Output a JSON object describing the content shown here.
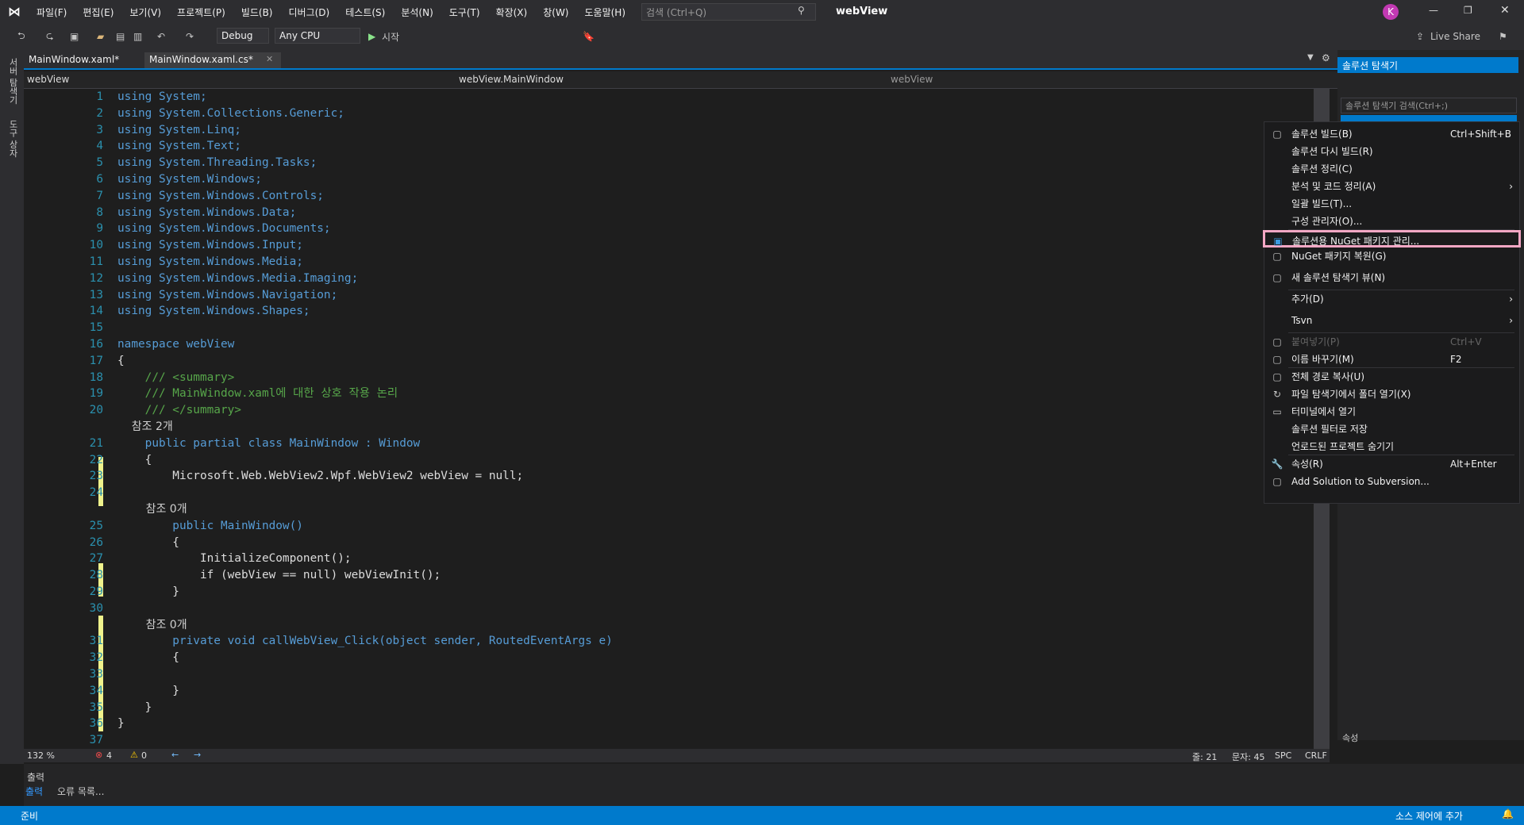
{
  "titlebar": {
    "menus": [
      "파일(F)",
      "편집(E)",
      "보기(V)",
      "프로젝트(P)",
      "빌드(B)",
      "디버그(D)",
      "테스트(S)",
      "분석(N)",
      "도구(T)",
      "확장(X)",
      "창(W)",
      "도움말(H)"
    ],
    "search_placeholder": "검색 (Ctrl+Q)",
    "project_name": "webView",
    "avatar_letter": "K"
  },
  "toolbar": {
    "config": "Debug",
    "platform": "Any CPU",
    "start_label": "시작",
    "live_share": "Live Share"
  },
  "leftbar": {
    "items": [
      "서버 탐색기",
      "도구 상자"
    ]
  },
  "editor": {
    "tabs": [
      {
        "label": "MainWindow.xaml*"
      },
      {
        "label": "MainWindow.xaml.cs*"
      }
    ],
    "nav": [
      "webView",
      "webView.MainWindow",
      "webView"
    ],
    "lines": [
      {
        "n": "1",
        "t": "using System;"
      },
      {
        "n": "2",
        "t": "using System.Collections.Generic;"
      },
      {
        "n": "3",
        "t": "using System.Linq;"
      },
      {
        "n": "4",
        "t": "using System.Text;"
      },
      {
        "n": "5",
        "t": "using System.Threading.Tasks;"
      },
      {
        "n": "6",
        "t": "using System.Windows;"
      },
      {
        "n": "7",
        "t": "using System.Windows.Controls;"
      },
      {
        "n": "8",
        "t": "using System.Windows.Data;"
      },
      {
        "n": "9",
        "t": "using System.Windows.Documents;"
      },
      {
        "n": "10",
        "t": "using System.Windows.Input;"
      },
      {
        "n": "11",
        "t": "using System.Windows.Media;"
      },
      {
        "n": "12",
        "t": "using System.Windows.Media.Imaging;"
      },
      {
        "n": "13",
        "t": "using System.Windows.Navigation;"
      },
      {
        "n": "14",
        "t": "using System.Windows.Shapes;"
      },
      {
        "n": "15",
        "t": ""
      },
      {
        "n": "16",
        "t": "namespace webView"
      },
      {
        "n": "17",
        "t": "{"
      },
      {
        "n": "18",
        "t": "    /// <summary>"
      },
      {
        "n": "19",
        "t": "    /// MainWindow.xaml에 대한 상호 작용 논리"
      },
      {
        "n": "20",
        "t": "    /// </summary>"
      },
      {
        "n": "",
        "t": "    참조 2개"
      },
      {
        "n": "21",
        "t": "    public partial class MainWindow : Window"
      },
      {
        "n": "22",
        "t": "    {"
      },
      {
        "n": "23",
        "t": "        Microsoft.Web.WebView2.Wpf.WebView2 webView = null;"
      },
      {
        "n": "24",
        "t": ""
      },
      {
        "n": "",
        "t": "        참조 0개"
      },
      {
        "n": "25",
        "t": "        public MainWindow()"
      },
      {
        "n": "26",
        "t": "        {"
      },
      {
        "n": "27",
        "t": "            InitializeComponent();"
      },
      {
        "n": "28",
        "t": "            if (webView == null) webViewInit();"
      },
      {
        "n": "29",
        "t": "        }"
      },
      {
        "n": "30",
        "t": ""
      },
      {
        "n": "",
        "t": "        참조 0개"
      },
      {
        "n": "31",
        "t": "        private void callWebView_Click(object sender, RoutedEventArgs e)"
      },
      {
        "n": "32",
        "t": "        {"
      },
      {
        "n": "33",
        "t": ""
      },
      {
        "n": "34",
        "t": "        }"
      },
      {
        "n": "35",
        "t": "    }"
      },
      {
        "n": "36",
        "t": "}"
      },
      {
        "n": "37",
        "t": ""
      }
    ]
  },
  "solution_explorer": {
    "title": "솔루션 탐색기",
    "search_placeholder": "솔루션 탐색기 검색(Ctrl+;)",
    "properties_title": "속성"
  },
  "context_menu": {
    "items": [
      {
        "label": "솔루션 빌드(B)",
        "shortcut": "Ctrl+Shift+B",
        "icon": "build-icon"
      },
      {
        "label": "솔루션 다시 빌드(R)",
        "shortcut": "",
        "icon": ""
      },
      {
        "label": "솔루션 정리(C)",
        "shortcut": "",
        "icon": ""
      },
      {
        "label": "분석 및 코드 정리(A)",
        "shortcut": "",
        "icon": "",
        "submenu": true
      },
      {
        "label": "일괄 빌드(T)...",
        "shortcut": "",
        "icon": ""
      },
      {
        "label": "구성 관리자(O)...",
        "shortcut": "",
        "icon": ""
      },
      {
        "label": "솔루션용 NuGet 패키지 관리...",
        "shortcut": "",
        "icon": "nuget-icon",
        "highlighted": true
      },
      {
        "label": "NuGet 패키지 복원(G)",
        "shortcut": "",
        "icon": "restore-icon"
      },
      {
        "label": "새 솔루션 탐색기 뷰(N)",
        "shortcut": "",
        "icon": "new-view-icon"
      },
      {
        "label": "추가(D)",
        "shortcut": "",
        "icon": "",
        "submenu": true
      },
      {
        "label": "Tsvn",
        "shortcut": "",
        "icon": "",
        "submenu": true
      },
      {
        "label": "붙여넣기(P)",
        "shortcut": "Ctrl+V",
        "icon": "paste-icon",
        "disabled": true
      },
      {
        "label": "이름 바꾸기(M)",
        "shortcut": "F2",
        "icon": "rename-icon"
      },
      {
        "label": "전체 경로 복사(U)",
        "shortcut": "",
        "icon": "copy-icon"
      },
      {
        "label": "파일 탐색기에서 폴더 열기(X)",
        "shortcut": "",
        "icon": "open-folder-icon"
      },
      {
        "label": "터미널에서 열기",
        "shortcut": "",
        "icon": "terminal-icon"
      },
      {
        "label": "솔루션 필터로 저장",
        "shortcut": "",
        "icon": ""
      },
      {
        "label": "언로드된 프로젝트 숨기기",
        "shortcut": "",
        "icon": ""
      },
      {
        "label": "속성(R)",
        "shortcut": "Alt+Enter",
        "icon": "wrench-icon"
      },
      {
        "label": "Add Solution to Subversion...",
        "shortcut": "",
        "icon": "svn-icon"
      }
    ]
  },
  "statusline": {
    "zoom": "132 %",
    "errors": "4",
    "warnings": "0",
    "line": "줄: 21",
    "col": "문자: 45",
    "spc": "SPC",
    "crlf": "CRLF"
  },
  "output": {
    "title": "출력",
    "tabs": [
      "출력",
      "오류 목록..."
    ]
  },
  "statusbar": {
    "ready": "준비",
    "source_control": "소스 제어에 추가"
  },
  "colors": {
    "accent": "#007acc",
    "highlight_border": "#f4a7c4",
    "change_bar": "#eff28c"
  }
}
